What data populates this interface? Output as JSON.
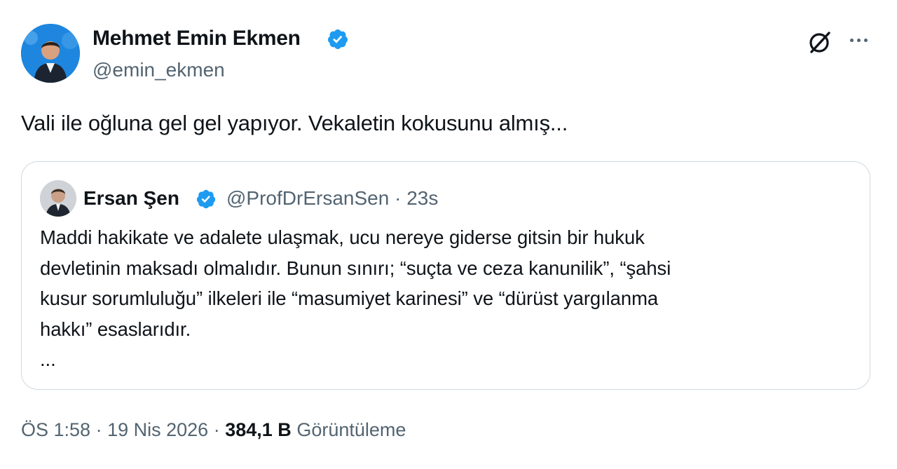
{
  "author": {
    "name": "Mehmet Emin Ekmen",
    "handle": "@emin_ekmen",
    "verified": true
  },
  "icons": {
    "verified": "verified-badge-icon",
    "grok": "grok-icon",
    "more": "more-icon"
  },
  "tweet": {
    "text": "Vali ile oğluna gel gel yapıyor. Vekaletin kokusunu almış..."
  },
  "quoted": {
    "name": "Ersan Şen",
    "handle": "@ProfDrErsanSen",
    "separator": "·",
    "time": "23s",
    "lines": [
      "Maddi hakikate ve adalete ulaşmak, ucu nereye giderse gitsin bir hukuk",
      "devletinin maksadı olmalıdır. Bunun sınırı; “suçta ve ceza kanunilik”, “şahsi",
      "kusur sorumluluğu” ilkeleri ile “masumiyet karinesi” ve “dürüst yargılanma",
      "hakkı” esaslarıdır.",
      "..."
    ]
  },
  "meta": {
    "time": "ÖS 1:58",
    "sep1": "·",
    "date": "19 Nis 2026",
    "sep2": "·",
    "views": "384,1 B",
    "views_label": "Görüntüleme"
  },
  "colors": {
    "verified": "#1d9bf0",
    "secondary_text": "#536471",
    "primary_text": "#0f1419",
    "border": "#cfd9de"
  }
}
